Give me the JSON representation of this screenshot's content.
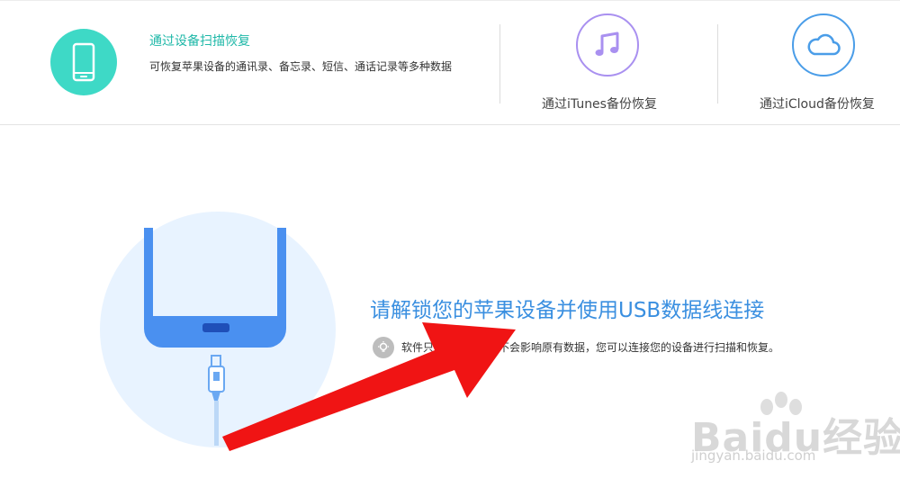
{
  "modes": {
    "scan": {
      "title": "通过设备扫描恢复",
      "description": "可恢复苹果设备的通讯录、备忘录、短信、通话记录等多种数据",
      "icon": "phone-icon",
      "color": "#3ed9c6"
    },
    "itunes": {
      "label": "通过iTunes备份恢复",
      "icon": "music-note-icon",
      "color": "#a990f0"
    },
    "icloud": {
      "label": "通过iCloud备份恢复",
      "icon": "cloud-icon",
      "color": "#4a9de8"
    }
  },
  "main": {
    "title": "请解锁您的苹果设备并使用USB数据线连接",
    "tip_icon": "lightbulb-icon",
    "tip": "软件只会读取数据，不会影响原有数据，您可以连接您的设备进行扫描和恢复。",
    "accent_color": "#3a8fe0"
  },
  "annotation": {
    "arrow_color": "#f01414"
  },
  "watermark": {
    "brand": "Baidu经验",
    "url": "jingyan.baidu.com"
  }
}
